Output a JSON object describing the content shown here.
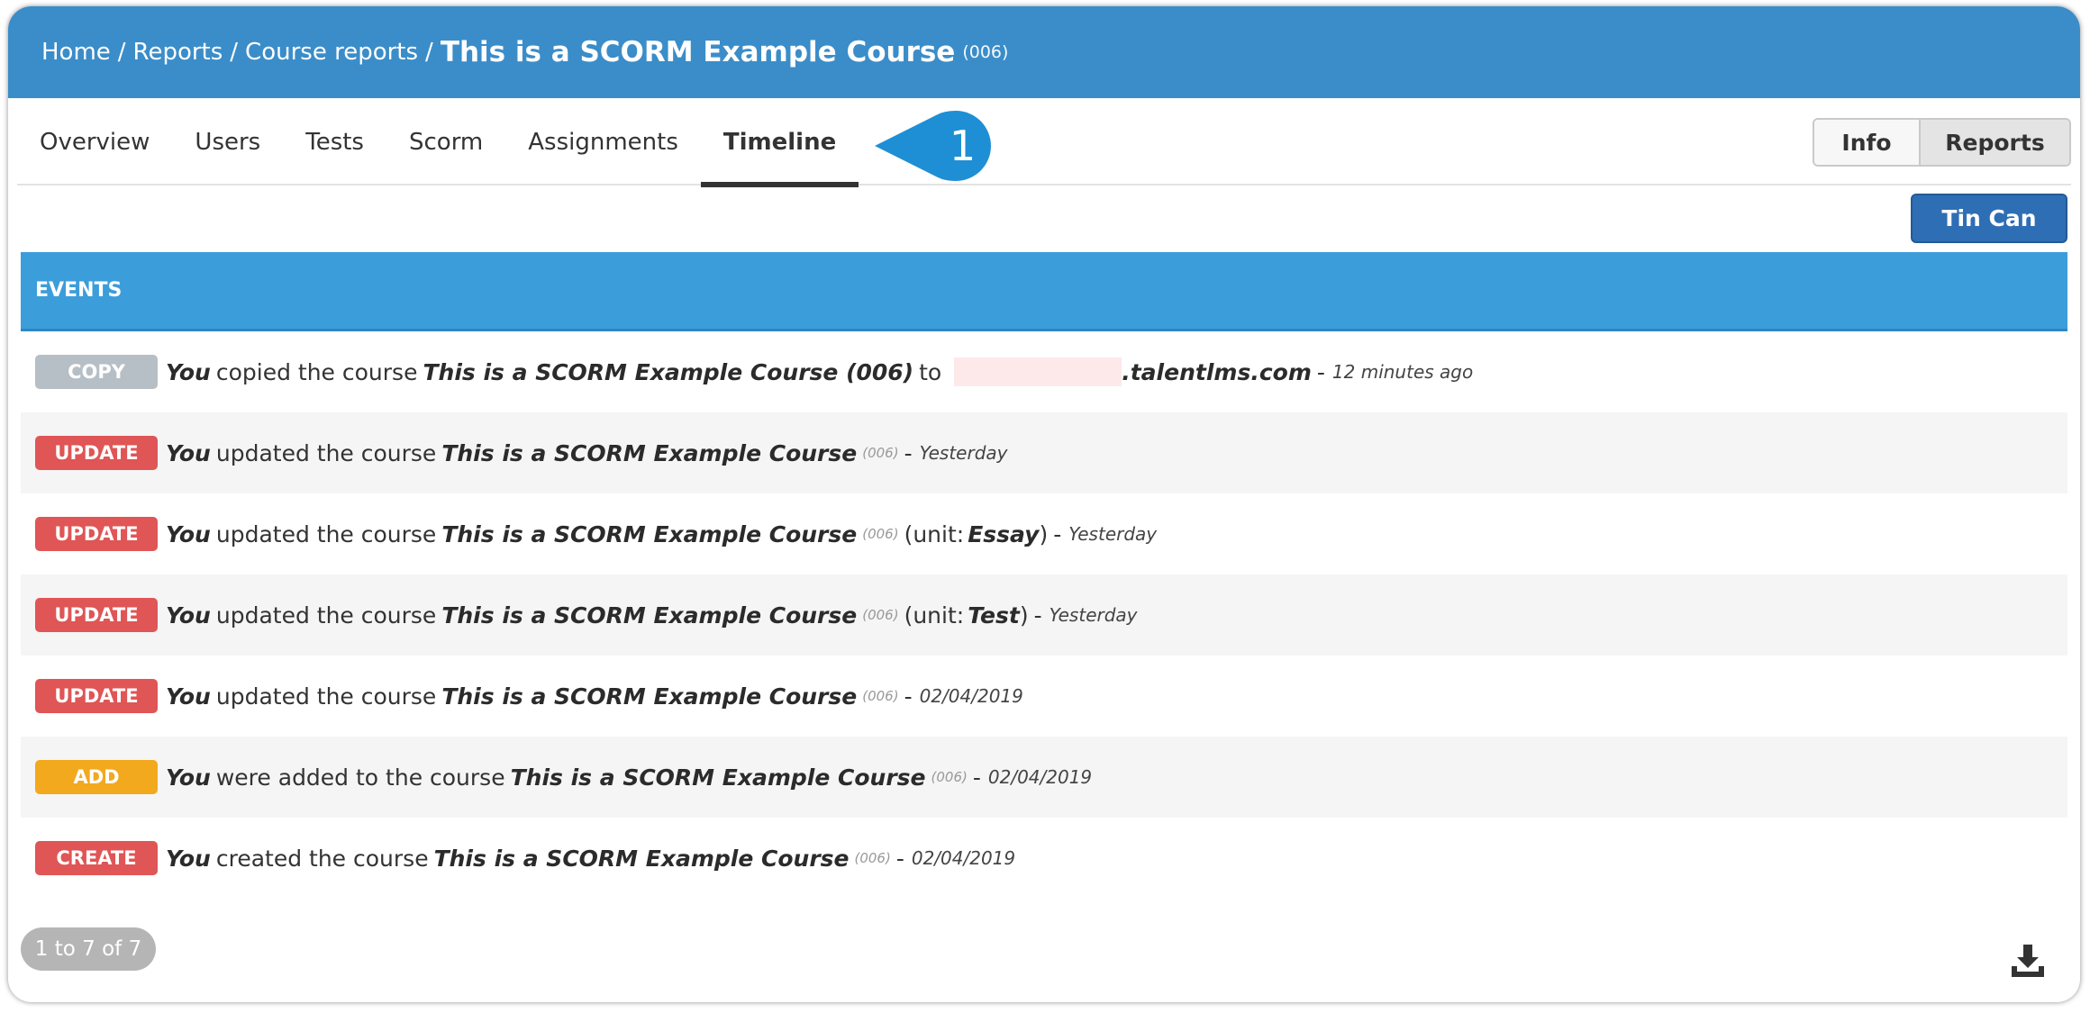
{
  "breadcrumb": {
    "home": "Home",
    "reports": "Reports",
    "course_reports": "Course reports",
    "separator": "/",
    "current": "This is a SCORM Example Course",
    "code": "(006)"
  },
  "tabs": [
    {
      "label": "Overview",
      "active": false
    },
    {
      "label": "Users",
      "active": false
    },
    {
      "label": "Tests",
      "active": false
    },
    {
      "label": "Scorm",
      "active": false
    },
    {
      "label": "Assignments",
      "active": false
    },
    {
      "label": "Timeline",
      "active": true
    }
  ],
  "callout": {
    "number": "1",
    "color": "#1e8fd4"
  },
  "view_toggle": {
    "info": "Info",
    "reports": "Reports",
    "selected": "Reports"
  },
  "actions": {
    "tincan": "Tin Can"
  },
  "events_header": "EVENTS",
  "events": [
    {
      "badge": "COPY",
      "actor": "You",
      "verb": "copied the course",
      "course": "This is a SCORM Example Course (006)",
      "to": "to",
      "domain": ".talentlms.com",
      "when": "12 minutes ago"
    },
    {
      "badge": "UPDATE",
      "actor": "You",
      "verb": "updated the course",
      "course": "This is a SCORM Example Course",
      "code": "(006)",
      "when": "Yesterday"
    },
    {
      "badge": "UPDATE",
      "actor": "You",
      "verb": "updated the course",
      "course": "This is a SCORM Example Course",
      "code": "(006)",
      "unit_open": "(unit:",
      "unit": "Essay",
      "unit_close": ")",
      "when": "Yesterday"
    },
    {
      "badge": "UPDATE",
      "actor": "You",
      "verb": "updated the course",
      "course": "This is a SCORM Example Course",
      "code": "(006)",
      "unit_open": "(unit:",
      "unit": "Test",
      "unit_close": ")",
      "when": "Yesterday"
    },
    {
      "badge": "UPDATE",
      "actor": "You",
      "verb": "updated the course",
      "course": "This is a SCORM Example Course",
      "code": "(006)",
      "when": "02/04/2019"
    },
    {
      "badge": "ADD",
      "actor": "You",
      "verb": "were added to the course",
      "course": "This is a SCORM Example Course",
      "code": "(006)",
      "when": "02/04/2019"
    },
    {
      "badge": "CREATE",
      "actor": "You",
      "verb": "created the course",
      "course": "This is a SCORM Example Course",
      "code": "(006)",
      "when": "02/04/2019"
    }
  ],
  "dash": "-",
  "pagination": "1 to 7 of 7",
  "icons": {
    "download": "download-icon"
  },
  "colors": {
    "header": "#3a8dc9",
    "events_header": "#3c9ddb",
    "copy": "#b6bfc6",
    "update": "#e05555",
    "add": "#f2a91d",
    "create": "#e05555",
    "tincan": "#2e6eb4"
  }
}
